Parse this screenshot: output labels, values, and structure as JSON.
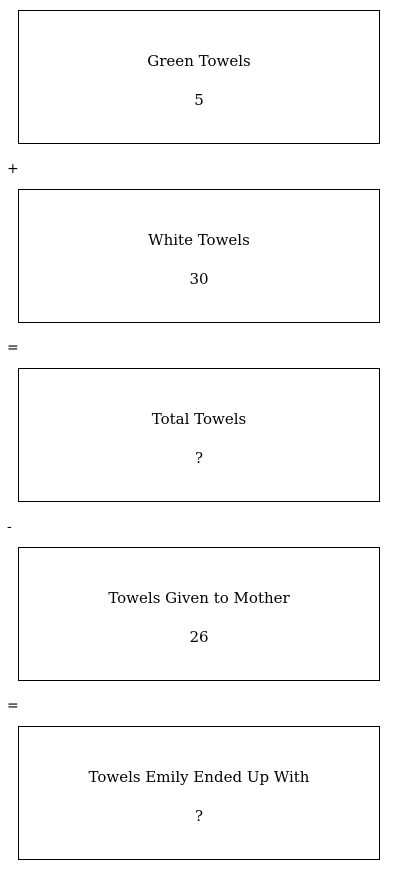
{
  "boxes": [
    {
      "label": "Green Towels",
      "value": "5"
    },
    {
      "label": "White Towels",
      "value": "30"
    },
    {
      "label": "Total Towels",
      "value": "?"
    },
    {
      "label": "Towels Given to Mother",
      "value": "26"
    },
    {
      "label": "Towels Emily Ended Up With",
      "value": "?"
    }
  ],
  "operators": [
    "+",
    "=",
    "-",
    "="
  ]
}
